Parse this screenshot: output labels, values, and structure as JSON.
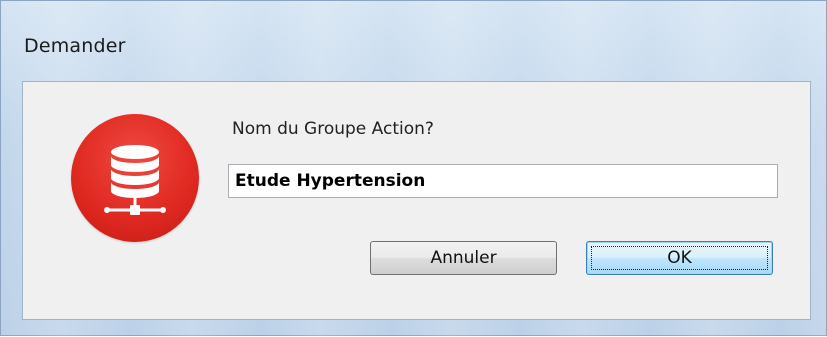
{
  "window": {
    "title": "Demander"
  },
  "dialog": {
    "icon": "database-network-icon",
    "prompt": "Nom du Groupe Action?",
    "input_value": "Etude Hypertension",
    "cancel_label": "Annuler",
    "ok_label": "OK"
  },
  "colors": {
    "icon_red": "#e02a22",
    "client_bg": "#f0f0f0",
    "titlebar_blue": "#c3d7ec"
  }
}
